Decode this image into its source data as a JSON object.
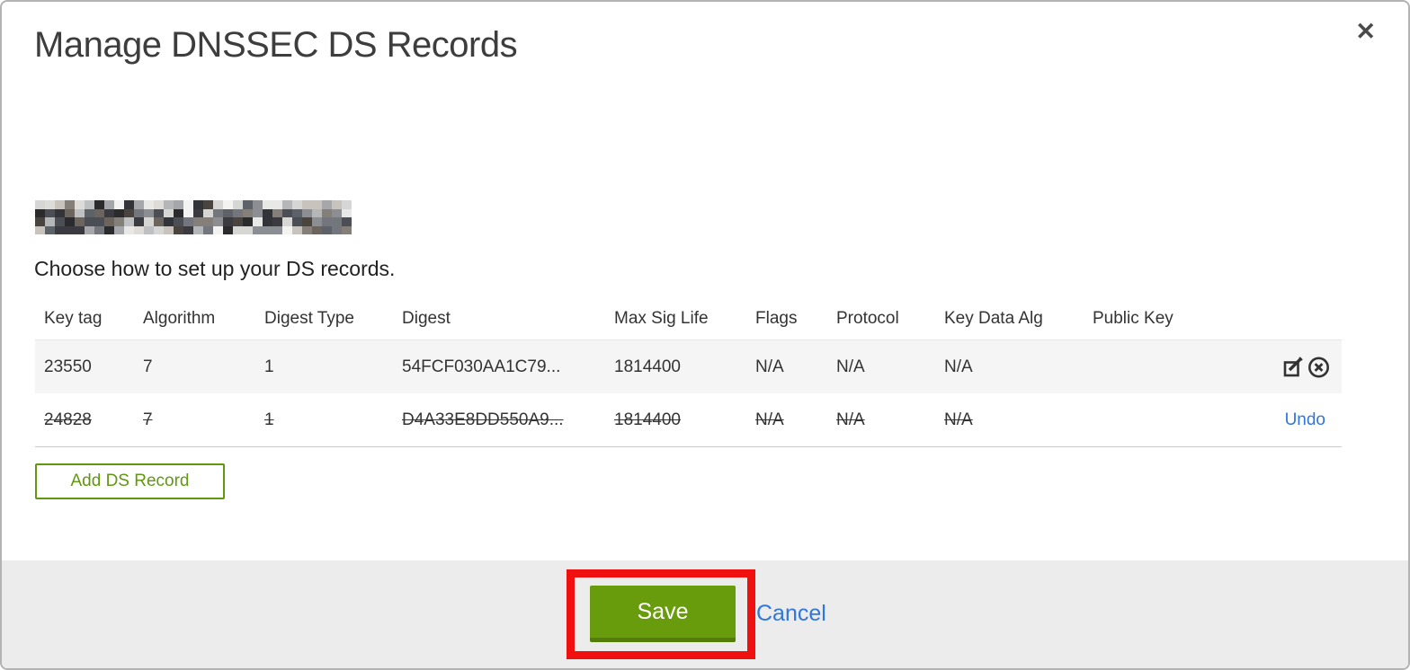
{
  "modal": {
    "title": "Manage DNSSEC DS Records",
    "close_glyph": "✕"
  },
  "intro_text": "Choose how to set up your DS records.",
  "redacted_domain": {
    "note": "pixelated-redaction",
    "palette_dark": [
      "#2b2b2e",
      "#3a3a40",
      "#4b4e55",
      "#5d6168",
      "#737骨67c",
      "#8b8e93",
      "#6b655e",
      "#4a443e"
    ],
    "palette_light": [
      "#a5a7aa",
      "#bfc0c1",
      "#d6d6d5",
      "#e8e8e7",
      "#c8c4bd",
      "#f3f3f2"
    ]
  },
  "table": {
    "headers": [
      "Key tag",
      "Algorithm",
      "Digest Type",
      "Digest",
      "Max Sig Life",
      "Flags",
      "Protocol",
      "Key Data Alg",
      "Public Key"
    ],
    "rows": [
      {
        "key_tag": "23550",
        "algorithm": "7",
        "digest_type": "1",
        "digest": "54FCF030AA1C79...",
        "max_sig_life": "1814400",
        "flags": "N/A",
        "protocol": "N/A",
        "key_data_alg": "N/A",
        "public_key": "",
        "state": "normal"
      },
      {
        "key_tag": "24828",
        "algorithm": "7",
        "digest_type": "1",
        "digest": "D4A33E8DD550A9...",
        "max_sig_life": "1814400",
        "flags": "N/A",
        "protocol": "N/A",
        "key_data_alg": "N/A",
        "public_key": "",
        "state": "deleted",
        "action_label": "Undo"
      }
    ]
  },
  "buttons": {
    "add_ds_record": "Add DS Record",
    "save": "Save",
    "cancel": "Cancel"
  },
  "colors": {
    "save_green": "#699c0c",
    "save_green_dark": "#547d0a",
    "add_record_green": "#61980f",
    "link_blue": "#2f76dd",
    "annotation_red": "#f11010",
    "footer_gray": "#ececec",
    "row_stripe_gray": "#f5f5f5",
    "title_gray": "#3d3d3d",
    "icon_dark": "#333333"
  }
}
